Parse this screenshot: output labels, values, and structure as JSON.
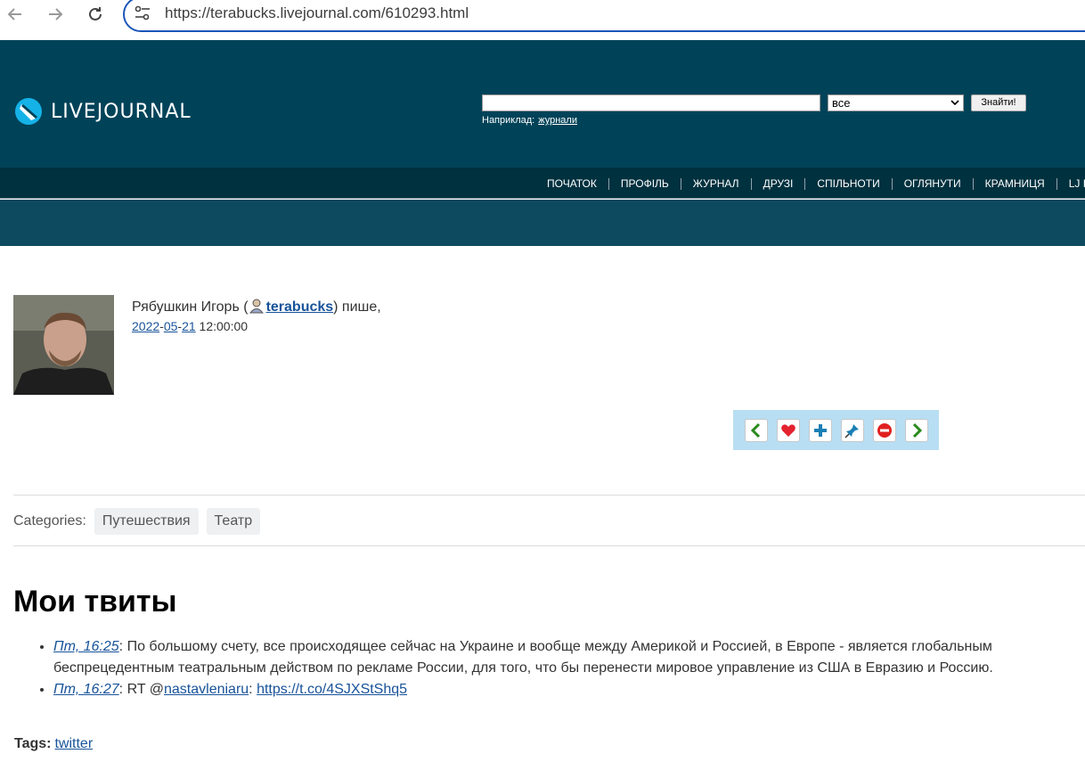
{
  "browser": {
    "url": "https://terabucks.livejournal.com/610293.html"
  },
  "header": {
    "logo_text": "LIVEJOURNAL",
    "search_placeholder": "",
    "search_scope": "все",
    "search_button": "Знайти!",
    "example_label": "Наприклад:",
    "example_link": "журнали"
  },
  "nav": {
    "items": [
      "ПОЧАТОК",
      "ПРОФІЛЬ",
      "ЖУРНАЛ",
      "ДРУЗІ",
      "СПІЛЬНОТИ",
      "ОГЛЯНУТИ",
      "КРАМНИЦЯ",
      "LJ I"
    ]
  },
  "post": {
    "author_name": "Рябушкин Игорь (",
    "username": "terabucks",
    "writes": ") пише,",
    "date_year": "2022",
    "date_month": "05",
    "date_day": "21",
    "time": "12:00:00",
    "categories_label": "Categories:",
    "categories": [
      "Путешествия",
      "Театр"
    ],
    "title": "Мои твиты",
    "tweets": [
      {
        "when": "Пт, 16:25",
        "text": ": По большому счету, все происходящее сейчас на Украине и вообще между Америкой и Россией, в Европе - является глобальным беспрецедентным театральным действом по рекламе России, для того, что бы перенести мировое управление из США в Евразию и Россию."
      },
      {
        "when": "Пт, 16:27",
        "prefix": ": RT @",
        "mention": "nastavleniaru",
        "sep": ": ",
        "link": "https://t.co/4SJXStShq5"
      }
    ],
    "tags_label": "Tags:",
    "tag": "twitter"
  },
  "colors": {
    "header_bg": "#004359",
    "nav_bg": "#00313f",
    "band_bg": "#0e4a5f",
    "link": "#18539a",
    "action_bg": "#b8def4"
  }
}
